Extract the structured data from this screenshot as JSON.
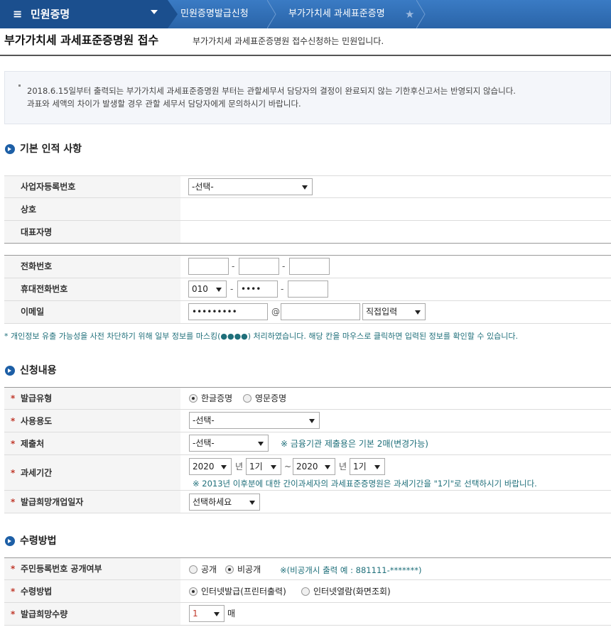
{
  "nav": {
    "menu_title": "민원증명",
    "breadcrumb1": "민원증명발급신청",
    "breadcrumb2": "부가가치세 과세표준증명"
  },
  "header": {
    "title": "부가가치세 과세표준증명원 접수",
    "desc": "부가가치세 과세표준증명원 접수신청하는 민원입니다."
  },
  "notice": {
    "line1": "2018.6.15일부터 출력되는 부가가치세 과세표준증명원 부터는 관할세무서 담당자의 결정이 완료되지 않는 기한후신고서는 반영되지 않습니다.",
    "line2": "과표와 세액의 차이가 발생할 경우 관할 세무서 담당자에게 문의하시기 바랍니다."
  },
  "section_basic": {
    "title": "기본 인적 사항",
    "biz_no_label": "사업자등록번호",
    "biz_no_value": "-선택-",
    "company_label": "상호",
    "rep_label": "대표자명",
    "phone_label": "전화번호",
    "phone_dash": "-",
    "mobile_label": "휴대전화번호",
    "mobile_prefix": "010",
    "mobile_mid": "••••",
    "email_label": "이메일",
    "email_local": "•••••••••",
    "email_at": "@",
    "email_domain_select": "직접입력",
    "privacy_note": "* 개인정보 유출 가능성을 사전 차단하기 위해 일부 정보를 마스킹(●●●●) 처리하였습니다. 해당 칸을 마우스로 클릭하면 입력된 정보를 확인할 수 있습니다."
  },
  "section_apply": {
    "title": "신청내용",
    "req_mark": "*",
    "type_label": "발급유형",
    "type_opt1": "한글증명",
    "type_opt2": "영문증명",
    "usage_label": "사용용도",
    "usage_value": "-선택-",
    "submit_label": "제출처",
    "submit_value": "-선택-",
    "submit_hint": "※ 금융기관 제출용은 기본 2매(변경가능)",
    "period_label": "과세기간",
    "from_year": "2020",
    "year_unit": "년",
    "from_term": "1기",
    "tilde": "~",
    "to_year": "2020",
    "to_term": "1기",
    "period_hint": "※ 2013년 이후분에 대한 간이과세자의 과세표준증명원은 과세기간을 \"1기\"로 선택하시기 바랍니다.",
    "open_date_label": "발급희망개업일자",
    "open_date_value": "선택하세요"
  },
  "section_receive": {
    "title": "수령방법",
    "req_mark": "*",
    "rrn_label": "주민등록번호 공개여부",
    "rrn_opt1": "공개",
    "rrn_opt2": "비공개",
    "rrn_hint": "※(비공개시 출력 예 : 881111-*******)",
    "method_label": "수령방법",
    "method_opt1": "인터넷발급(프린터출력)",
    "method_opt2": "인터넷열람(화면조회)",
    "qty_label": "발급희망수량",
    "qty_value": "1",
    "qty_unit": "매"
  },
  "colors": {
    "nav_bg": "#2f6fb5",
    "nav_menu_bg": "#1b4f8e",
    "section_icon": "#1d5fa6",
    "required": "#c0392b",
    "hint": "#1f6f7a"
  },
  "icons": [
    "hamburger-icon",
    "chevron-down-icon",
    "star-icon",
    "section-arrow-icon",
    "select-arrow-icon"
  ]
}
